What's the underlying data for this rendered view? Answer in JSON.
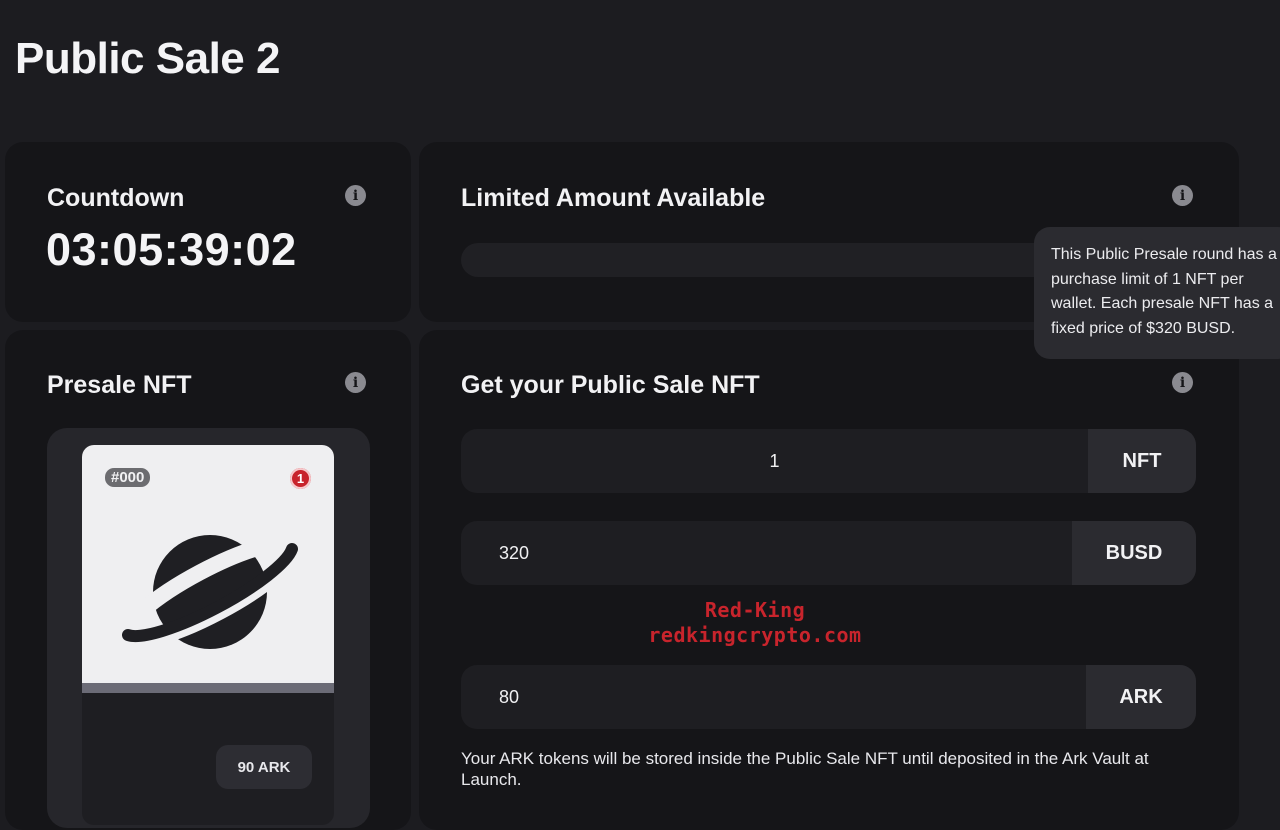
{
  "page": {
    "title": "Public Sale 2"
  },
  "countdown": {
    "title": "Countdown",
    "value": "03:05:39:02",
    "info_icon": "info-icon"
  },
  "limited": {
    "title": "Limited Amount Available",
    "info_icon": "info-icon",
    "progress_fraction": 0,
    "tooltip": "This Public Presale round has a\npurchase limit of 1 NFT per\nwallet. Each presale NFT has a\nfixed price of $320 BUSD."
  },
  "presale_nft": {
    "title": "Presale NFT",
    "info_icon": "info-icon",
    "card": {
      "id": "#000",
      "count": "1",
      "image_icon": "planet-icon",
      "price": "90 ARK"
    }
  },
  "purchase": {
    "title": "Get your Public Sale NFT",
    "info_icon": "info-icon",
    "nft_amount": {
      "value": "1",
      "unit": "NFT"
    },
    "busd_amount": {
      "value": "320",
      "unit": "BUSD"
    },
    "ark_amount": {
      "value": "80",
      "unit": "ARK"
    },
    "note": "Your ARK tokens will be stored inside the Public Sale NFT until deposited in the Ark Vault at Launch."
  },
  "watermark": {
    "line1": "Red-King",
    "line2": "redkingcrypto.com"
  },
  "colors": {
    "background": "#1c1c20",
    "card": "#151518",
    "input": "#1e1e22",
    "unit": "#2b2b30",
    "badge_red": "#c8232c",
    "watermark": "#c8242c"
  }
}
